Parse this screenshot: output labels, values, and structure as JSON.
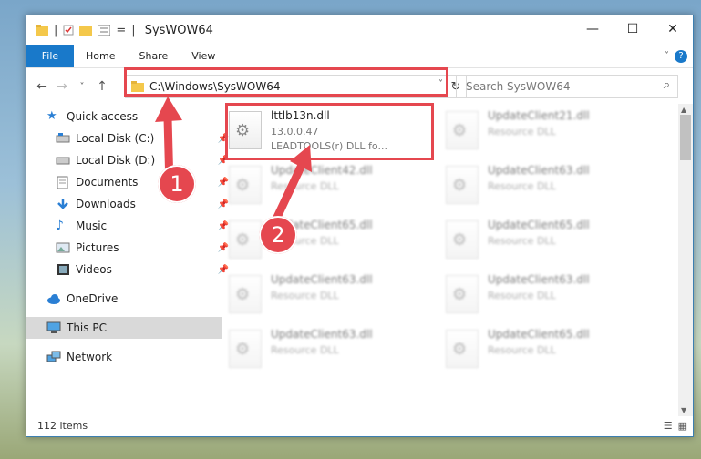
{
  "window": {
    "title": "SysWOW64",
    "qat_sep": "|",
    "qat_dd": "=",
    "minimize": "—",
    "maximize": "☐",
    "close": "✕"
  },
  "ribbon": {
    "tabs": [
      "File",
      "Home",
      "Share",
      "View"
    ],
    "help": "?"
  },
  "address": {
    "path": "C:\\Windows\\SysWOW64",
    "search_placeholder": "Search SysWOW64"
  },
  "nav": {
    "back": "←",
    "forward": "→",
    "recent": "˅",
    "up": "↑",
    "refresh": "↻",
    "dropdown": "˅",
    "search_icon": "⌕"
  },
  "sidebar": {
    "items": [
      {
        "label": "Quick access",
        "icon": "star-icon",
        "pinned": false
      },
      {
        "label": "Local Disk (C:)",
        "icon": "drive-icon",
        "pinned": true
      },
      {
        "label": "Local Disk (D:)",
        "icon": "drive-icon",
        "pinned": true
      },
      {
        "label": "Documents",
        "icon": "documents-icon",
        "pinned": true
      },
      {
        "label": "Downloads",
        "icon": "downloads-icon",
        "pinned": true
      },
      {
        "label": "Music",
        "icon": "music-icon",
        "pinned": true
      },
      {
        "label": "Pictures",
        "icon": "pictures-icon",
        "pinned": true
      },
      {
        "label": "Videos",
        "icon": "videos-icon",
        "pinned": true
      },
      {
        "label": "OneDrive",
        "icon": "cloud-icon",
        "pinned": false
      },
      {
        "label": "This PC",
        "icon": "computer-icon",
        "pinned": false,
        "selected": true
      },
      {
        "label": "Network",
        "icon": "network-icon",
        "pinned": false
      }
    ]
  },
  "files": [
    {
      "name": "lttlb13n.dll",
      "version": "13.0.0.47",
      "desc": "LEADTOOLS(r) DLL fo...",
      "highlighted": true
    },
    {
      "name": "UpdateClient21.dll",
      "version": "Resource DLL"
    },
    {
      "name": "UpdateClient42.dll",
      "version": "Resource DLL"
    },
    {
      "name": "UpdateClient63.dll",
      "version": "Resource DLL"
    },
    {
      "name": "UpdateClient65.dll",
      "version": "Resource DLL"
    },
    {
      "name": "UpdateClient65.dll",
      "version": "Resource DLL"
    },
    {
      "name": "UpdateClient63.dll",
      "version": "Resource DLL"
    },
    {
      "name": "UpdateClient63.dll",
      "version": "Resource DLL"
    },
    {
      "name": "UpdateClient63.dll",
      "version": "Resource DLL"
    },
    {
      "name": "UpdateClient65.dll",
      "version": "Resource DLL"
    }
  ],
  "status": {
    "count": "112 items"
  },
  "annotations": {
    "badge1": "1",
    "badge2": "2",
    "color": "#e5474f"
  }
}
